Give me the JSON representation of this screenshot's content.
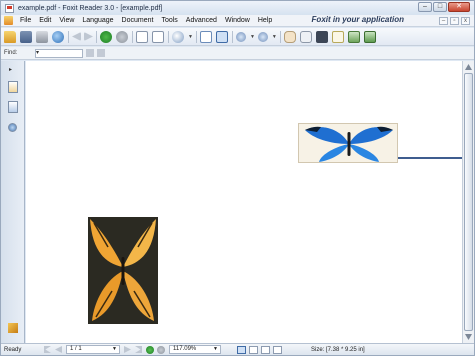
{
  "window": {
    "title": "example.pdf - Foxit Reader 3.0 - [example.pdf]",
    "controls": [
      "minimize",
      "maximize",
      "close"
    ]
  },
  "menubar": {
    "items": [
      "File",
      "Edit",
      "View",
      "Language",
      "Document",
      "Tools",
      "Advanced",
      "Window",
      "Help"
    ],
    "brand_text": "Foxit in your application"
  },
  "toolbar": {
    "icons": [
      "open-folder-icon",
      "save-icon",
      "print-icon",
      "email-icon",
      "previous-page-icon",
      "next-page-icon",
      "go-forward-icon",
      "stop-icon",
      "rotate-left-icon",
      "rotate-right-icon",
      "zoom-icon",
      "fit-page-icon",
      "fit-width-icon",
      "zoom-out-icon",
      "zoom-in-icon",
      "hand-tool-icon",
      "glasses-icon",
      "find-icon",
      "text-tool-icon",
      "image-icon",
      "snapshot-icon"
    ]
  },
  "findbar": {
    "label": "Find:",
    "value": ""
  },
  "statusbar": {
    "status": "Ready",
    "page": "1 / 1",
    "zoom": "117.09%",
    "size": "Size: [7.38 * 9.25 in]"
  },
  "colors": {
    "accent": "#3f6ba6",
    "title_bar": "#d6e2f0",
    "link_line": "#3f5d8f"
  }
}
